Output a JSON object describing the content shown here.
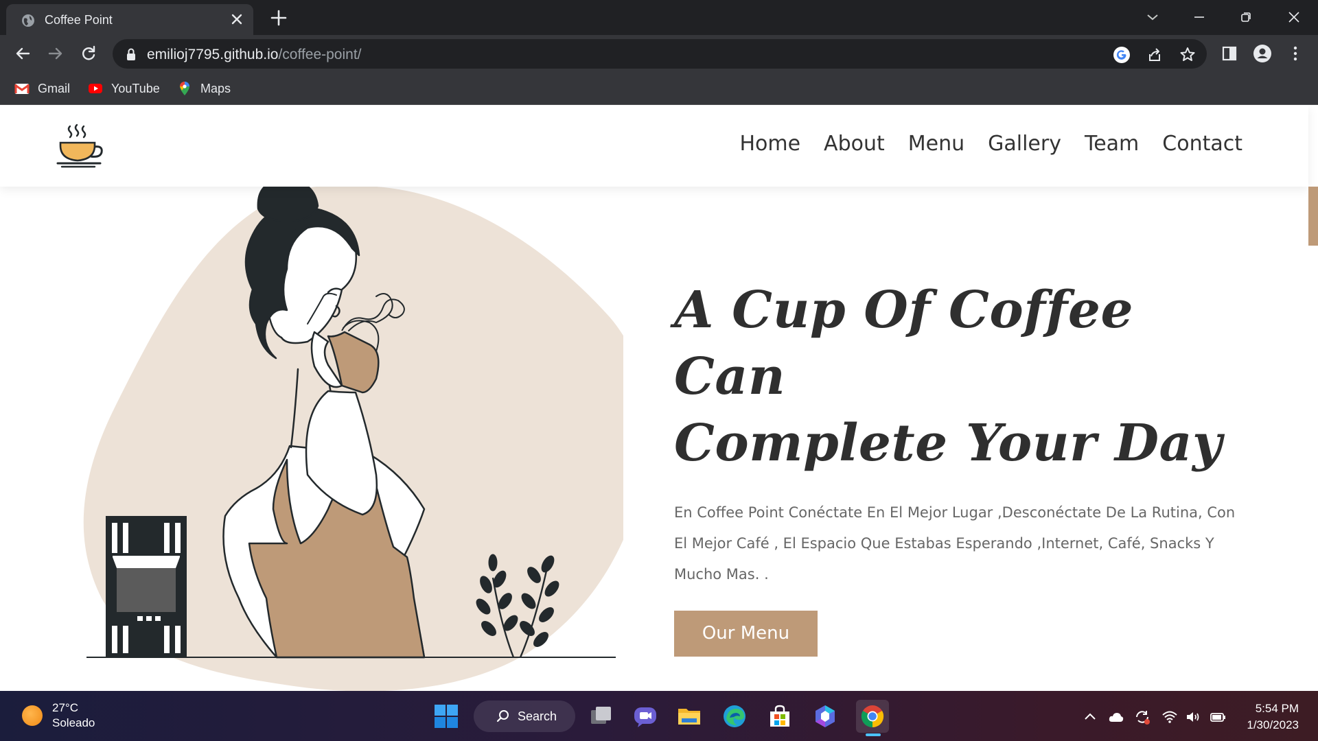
{
  "browser": {
    "tab_title": "Coffee Point",
    "url_host": "emilioj7795.github.io",
    "url_path": "/coffee-point/",
    "bookmarks": [
      {
        "label": "Gmail",
        "icon": "gmail-icon"
      },
      {
        "label": "YouTube",
        "icon": "youtube-icon"
      },
      {
        "label": "Maps",
        "icon": "maps-icon"
      }
    ]
  },
  "site": {
    "nav": [
      "Home",
      "About",
      "Menu",
      "Gallery",
      "Team",
      "Contact"
    ],
    "hero": {
      "title_line1": "A Cup Of Coffee Can",
      "title_line2": "Complete Your Day",
      "description": "En Coffee Point Conéctate En El Mejor Lugar ,Desconéctate De La Rutina, Con El Mejor Café , El Espacio Que Estabas Esperando ,Internet, Café, Snacks Y Mucho Mas. .",
      "button": "Our Menu"
    },
    "colors": {
      "accent": "#be9a78",
      "blob": "#ede2d7",
      "ink": "#23292c"
    }
  },
  "taskbar": {
    "weather_temp": "27°C",
    "weather_desc": "Soleado",
    "search_label": "Search",
    "time": "5:54 PM",
    "date": "1/30/2023"
  }
}
